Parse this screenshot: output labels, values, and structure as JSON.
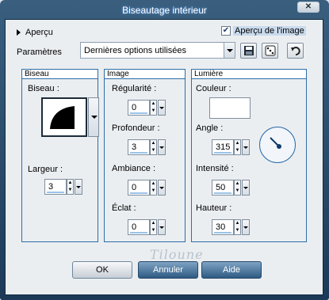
{
  "window": {
    "title": "Biseautage intérieur"
  },
  "preview": {
    "label": "Aperçu",
    "checkbox_label": "Aperçu de l'image",
    "checked": true
  },
  "params": {
    "label": "Paramètres",
    "preset_value": "Dernières options utilisées"
  },
  "bevel": {
    "title": "Biseau",
    "shape_label": "Biseau :",
    "width_label": "Largeur :",
    "width_value": "3"
  },
  "image": {
    "title": "Image",
    "regularity_label": "Régularité :",
    "regularity_value": "0",
    "depth_label": "Profondeur :",
    "depth_value": "3",
    "ambiance_label": "Ambiance :",
    "ambiance_value": "0",
    "shine_label": "Éclat :",
    "shine_value": "0"
  },
  "light": {
    "title": "Lumière",
    "color_label": "Couleur :",
    "color_value": "#ffffff",
    "angle_label": "Angle :",
    "angle_value": "315",
    "intensity_label": "Intensité :",
    "intensity_value": "50",
    "height_label": "Hauteur :",
    "height_value": "30"
  },
  "buttons": {
    "ok": "OK",
    "cancel": "Annuler",
    "help": "Aide"
  },
  "watermark": "Tiloune",
  "icons": [
    "close-icon",
    "triangle-right-icon",
    "checkmark-icon",
    "save-icon",
    "dice-icon",
    "undo-icon",
    "bevel-shape-icon",
    "angle-dial-icon"
  ],
  "colors": {
    "accent": "#2c6ea8",
    "title_bar": "#1c3a58",
    "button_blue": "#2e5a82"
  }
}
